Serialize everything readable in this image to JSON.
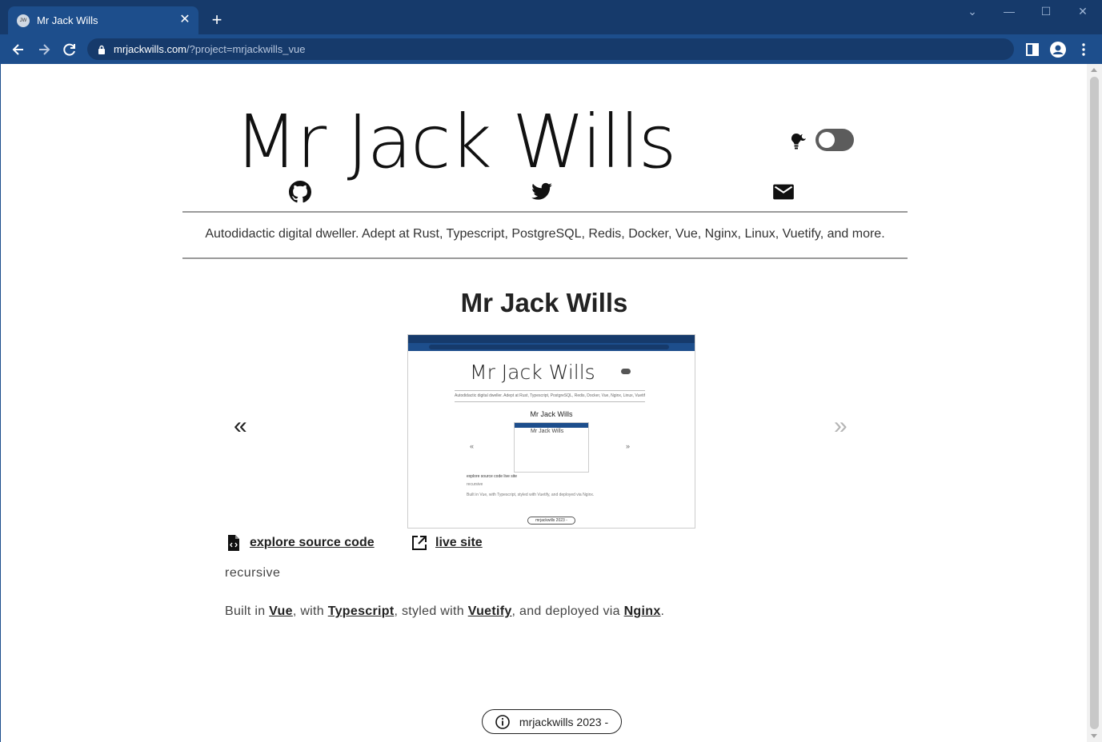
{
  "browser": {
    "tab_title": "Mr Jack Wills",
    "favicon_text": "JW",
    "url_host": "mrjackwills.com",
    "url_path": "/?project=mrjackwills_vue"
  },
  "header": {
    "title": "Mr Jack Wills",
    "social": [
      "github-icon",
      "twitter-icon",
      "mail-icon"
    ],
    "tagline": "Autodidactic digital dweller. Adept at Rust, Typescript, PostgreSQL, Redis, Docker, Vue, Nginx, Linux, Vuetify, and more."
  },
  "project": {
    "title": "Mr Jack Wills",
    "prev_arrow": "«",
    "next_arrow": "»",
    "thumbnail": {
      "title": "Mr Jack Wills",
      "tagline": "Autodidactic digital dweller. Adept at Rust, Typescript, PostgreSQL, Redis, Docker, Vue, Nginx, Linux, Vuetify, and more.",
      "project_title": "Mr Jack Wills",
      "inner_title": "Mr Jack Wills",
      "links": "explore source code      live site",
      "recursive": "recursive",
      "built": "Built in Vue, with Typescript, styled with Vuetify, and deployed via Nginx.",
      "footer": "mrjackwills 2023 -"
    },
    "source_link": "explore source code",
    "live_link": "live site",
    "description": "recursive",
    "built": {
      "prefix": "Built in ",
      "vue": "Vue",
      "with": ", with ",
      "typescript": "Typescript",
      "styled": ", styled with ",
      "vuetify": "Vuetify",
      "deployed": ", and deployed via ",
      "nginx": "Nginx",
      "suffix": "."
    }
  },
  "footer": {
    "text": "mrjackwills 2023 -"
  },
  "colors": {
    "chrome_dark": "#163a6b",
    "chrome": "#1d4e8c",
    "text": "#222222"
  }
}
